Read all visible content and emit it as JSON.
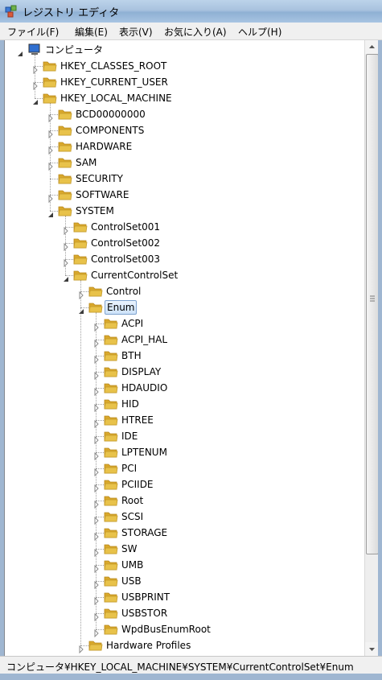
{
  "window": {
    "title": "レジストリ エディタ"
  },
  "menu": [
    {
      "label": "ファイル(F)"
    },
    {
      "label": "編集(E)"
    },
    {
      "label": "表示(V)"
    },
    {
      "label": "お気に入り(A)"
    },
    {
      "label": "ヘルプ(H)"
    }
  ],
  "tree": [
    {
      "label": "コンピュータ",
      "level": 0,
      "state": "expanded",
      "icon": "computer-icon"
    },
    {
      "label": "HKEY_CLASSES_ROOT",
      "level": 1,
      "state": "collapsed"
    },
    {
      "label": "HKEY_CURRENT_USER",
      "level": 1,
      "state": "collapsed"
    },
    {
      "label": "HKEY_LOCAL_MACHINE",
      "level": 1,
      "state": "expanded"
    },
    {
      "label": "BCD00000000",
      "level": 2,
      "state": "collapsed"
    },
    {
      "label": "COMPONENTS",
      "level": 2,
      "state": "collapsed"
    },
    {
      "label": "HARDWARE",
      "level": 2,
      "state": "collapsed"
    },
    {
      "label": "SAM",
      "level": 2,
      "state": "collapsed"
    },
    {
      "label": "SECURITY",
      "level": 2,
      "state": "none"
    },
    {
      "label": "SOFTWARE",
      "level": 2,
      "state": "collapsed"
    },
    {
      "label": "SYSTEM",
      "level": 2,
      "state": "expanded"
    },
    {
      "label": "ControlSet001",
      "level": 3,
      "state": "collapsed"
    },
    {
      "label": "ControlSet002",
      "level": 3,
      "state": "collapsed"
    },
    {
      "label": "ControlSet003",
      "level": 3,
      "state": "collapsed"
    },
    {
      "label": "CurrentControlSet",
      "level": 3,
      "state": "expanded"
    },
    {
      "label": "Control",
      "level": 4,
      "state": "collapsed"
    },
    {
      "label": "Enum",
      "level": 4,
      "state": "expanded",
      "selected": true
    },
    {
      "label": "ACPI",
      "level": 5,
      "state": "collapsed"
    },
    {
      "label": "ACPI_HAL",
      "level": 5,
      "state": "collapsed"
    },
    {
      "label": "BTH",
      "level": 5,
      "state": "collapsed"
    },
    {
      "label": "DISPLAY",
      "level": 5,
      "state": "collapsed"
    },
    {
      "label": "HDAUDIO",
      "level": 5,
      "state": "collapsed"
    },
    {
      "label": "HID",
      "level": 5,
      "state": "collapsed"
    },
    {
      "label": "HTREE",
      "level": 5,
      "state": "collapsed"
    },
    {
      "label": "IDE",
      "level": 5,
      "state": "collapsed"
    },
    {
      "label": "LPTENUM",
      "level": 5,
      "state": "collapsed"
    },
    {
      "label": "PCI",
      "level": 5,
      "state": "collapsed"
    },
    {
      "label": "PCIIDE",
      "level": 5,
      "state": "collapsed"
    },
    {
      "label": "Root",
      "level": 5,
      "state": "collapsed"
    },
    {
      "label": "SCSI",
      "level": 5,
      "state": "collapsed"
    },
    {
      "label": "STORAGE",
      "level": 5,
      "state": "collapsed"
    },
    {
      "label": "SW",
      "level": 5,
      "state": "collapsed"
    },
    {
      "label": "UMB",
      "level": 5,
      "state": "collapsed"
    },
    {
      "label": "USB",
      "level": 5,
      "state": "collapsed"
    },
    {
      "label": "USBPRINT",
      "level": 5,
      "state": "collapsed"
    },
    {
      "label": "USBSTOR",
      "level": 5,
      "state": "collapsed"
    },
    {
      "label": "WpdBusEnumRoot",
      "level": 5,
      "state": "collapsed"
    },
    {
      "label": "Hardware Profiles",
      "level": 4,
      "state": "collapsed"
    }
  ],
  "status": {
    "path": "コンピュータ¥HKEY_LOCAL_MACHINE¥SYSTEM¥CurrentControlSet¥Enum"
  },
  "colors": {
    "folder": "#e8c24a",
    "selection_border": "#7da2ce",
    "titlebar": "#a9c2de"
  }
}
